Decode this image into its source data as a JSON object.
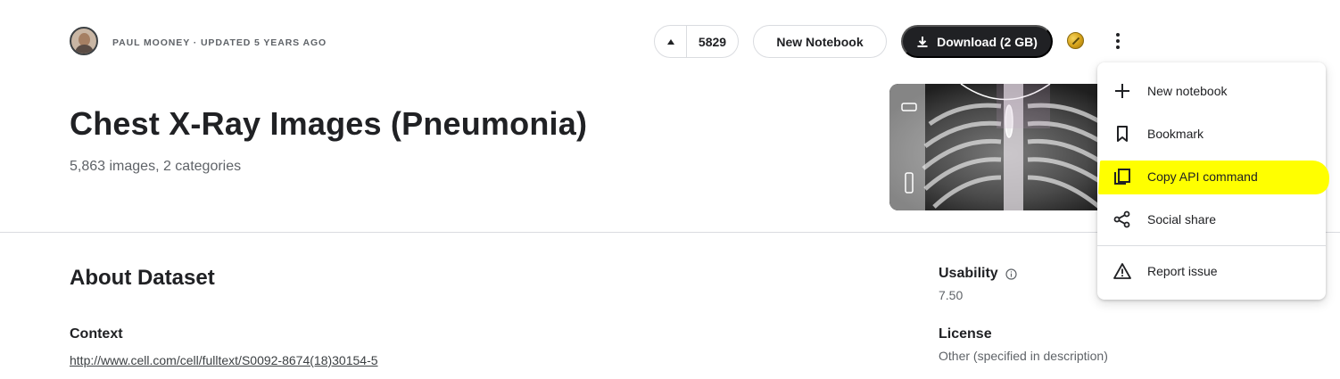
{
  "header": {
    "author_line": "PAUL MOONEY · UPDATED 5 YEARS AGO",
    "vote_count": "5829",
    "new_notebook_label": "New Notebook",
    "download_label": "Download (2 GB)"
  },
  "dataset": {
    "title": "Chest X-Ray Images (Pneumonia)",
    "subtitle": "5,863 images, 2 categories"
  },
  "about": {
    "heading": "About Dataset",
    "context_heading": "Context",
    "context_link": "http://www.cell.com/cell/fulltext/S0092-8674(18)30154-5"
  },
  "sidebar": {
    "usability_label": "Usability",
    "usability_value": "7.50",
    "license_label": "License",
    "license_value": "Other (specified in description)"
  },
  "menu": {
    "items": [
      {
        "label": "New notebook",
        "icon": "plus-icon"
      },
      {
        "label": "Bookmark",
        "icon": "bookmark-icon"
      },
      {
        "label": "Copy API command",
        "icon": "copy-icon",
        "highlighted": true
      },
      {
        "label": "Social share",
        "icon": "share-icon"
      },
      {
        "label": "Report issue",
        "icon": "warning-icon"
      }
    ]
  },
  "colors": {
    "primary_dark": "#202124",
    "highlight": "#ffff00",
    "muted_text": "#5f6368"
  }
}
